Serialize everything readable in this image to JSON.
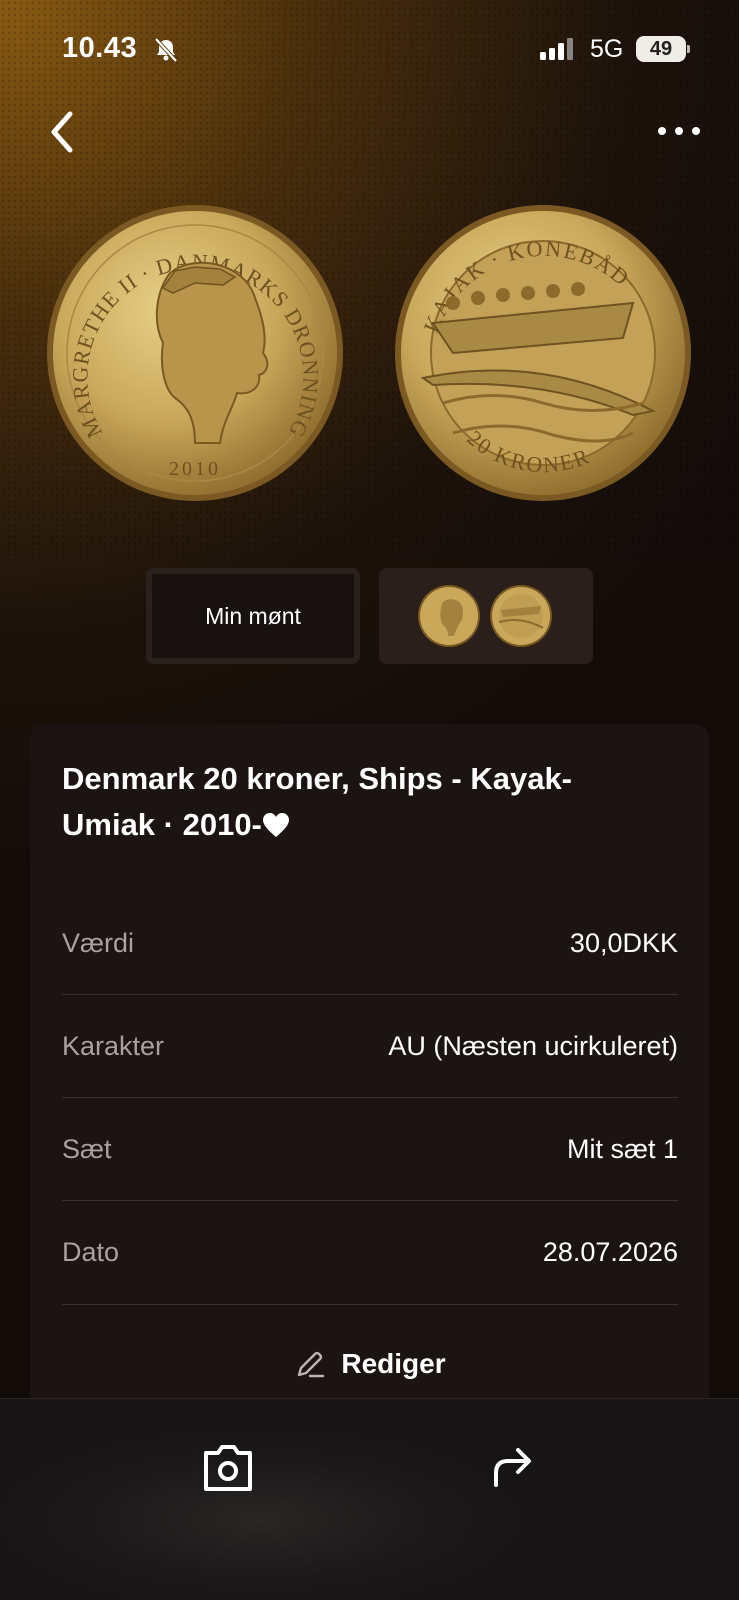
{
  "status_bar": {
    "time": "10.43",
    "network": "5G",
    "battery": "49"
  },
  "coin_images": {
    "obverse_legend": "MARGRETHE II · DANMARKS DRONNING",
    "obverse_year": "2010",
    "reverse_legend_top": "KAJAK · KONEBÅD",
    "reverse_legend_bottom": "20 KRONER"
  },
  "image_tabs": {
    "my_coin_label": "Min mønt"
  },
  "coin": {
    "title": "Denmark 20 kroner, Ships - Kayak-Umiak · 2010-"
  },
  "details": [
    {
      "key": "Værdi",
      "value": "30,0DKK"
    },
    {
      "key": "Karakter",
      "value": "AU (Næsten ucirkuleret)"
    },
    {
      "key": "Sæt",
      "value": "Mit sæt 1"
    },
    {
      "key": "Dato",
      "value": "28.07.2026"
    }
  ],
  "actions": {
    "edit_label": "Rediger"
  },
  "icons": {
    "back": "chevron-left-icon",
    "more": "more-horizontal-icon",
    "mute": "bell-slash-icon",
    "favorite": "heart-icon",
    "edit": "pencil-icon",
    "photo": "camera-icon",
    "share": "share-arrow-icon"
  },
  "colors": {
    "background_dark": "#120c09",
    "gold_glow": "#8a5a12",
    "card": "#1c1412",
    "muted_text": "#a9a19d"
  }
}
